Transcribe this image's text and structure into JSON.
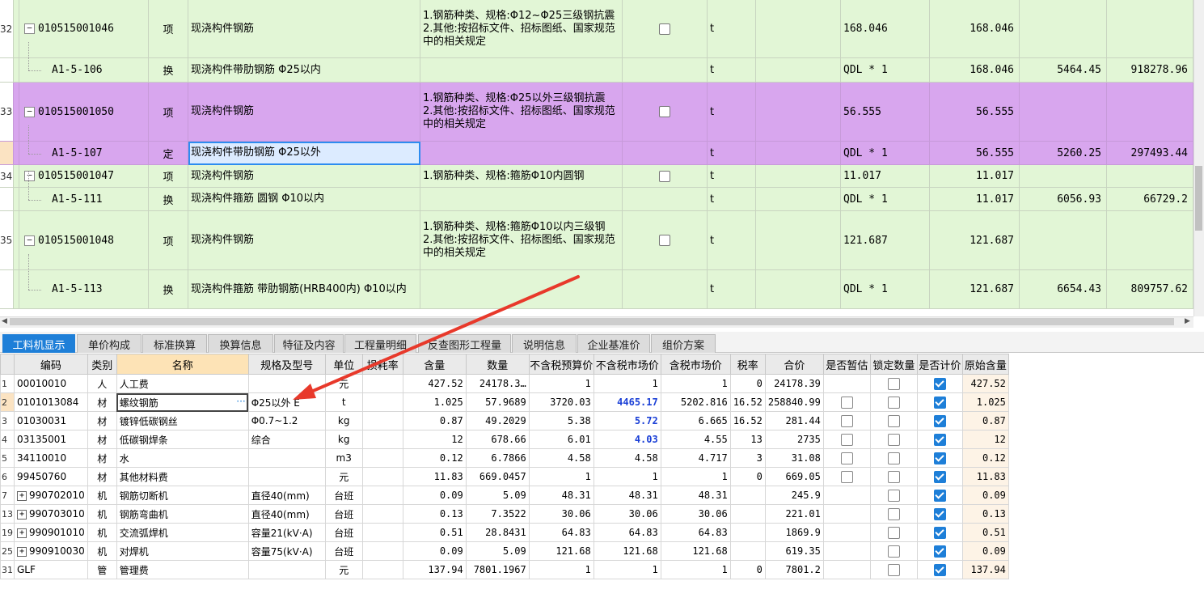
{
  "upper": {
    "rows": [
      {
        "idx": "32",
        "tree": "−",
        "code": "010515001046",
        "type": "项",
        "name": "现浇构件钢筋",
        "feature": "1.钢筋种类、规格:Φ12~Φ25三级钢抗震\n2.其他:按招标文件、招标图纸、国家规范中的相关规定",
        "unit": "t",
        "expr": "168.046",
        "qty": "168.046",
        "price": "",
        "total": ""
      },
      {
        "idx": "",
        "tree": "",
        "code": "A1-5-106",
        "type": "换",
        "name": "现浇构件带肋钢筋 Φ25以内",
        "feature": "",
        "unit": "t",
        "expr": "QDL * 1",
        "qty": "168.046",
        "price": "5464.45",
        "total": "918278.96"
      },
      {
        "idx": "33",
        "tree": "−",
        "code": "010515001050",
        "type": "项",
        "name": "现浇构件钢筋",
        "feature": "1.钢筋种类、规格:Φ25以外三级钢抗震\n2.其他:按招标文件、招标图纸、国家规范中的相关规定",
        "unit": "t",
        "expr": "56.555",
        "qty": "56.555",
        "price": "",
        "total": ""
      },
      {
        "idx": "",
        "tree": "",
        "code": "A1-5-107",
        "type": "定",
        "name": "现浇构件带肋钢筋 Φ25以外",
        "feature": "",
        "unit": "t",
        "expr": "QDL * 1",
        "qty": "56.555",
        "price": "5260.25",
        "total": "297493.44"
      },
      {
        "idx": "34",
        "tree": "−",
        "code": "010515001047",
        "type": "项",
        "name": "现浇构件钢筋",
        "feature": "1.钢筋种类、规格:箍筋Φ10内圆钢",
        "unit": "t",
        "expr": "11.017",
        "qty": "11.017",
        "price": "",
        "total": ""
      },
      {
        "idx": "",
        "tree": "",
        "code": "A1-5-111",
        "type": "换",
        "name": "现浇构件箍筋 圆钢 Φ10以内",
        "feature": "",
        "unit": "t",
        "expr": "QDL * 1",
        "qty": "11.017",
        "price": "6056.93",
        "total": "66729.2"
      },
      {
        "idx": "35",
        "tree": "−",
        "code": "010515001048",
        "type": "项",
        "name": "现浇构件钢筋",
        "feature": "1.钢筋种类、规格:箍筋Φ10以内三级钢\n2.其他:按招标文件、招标图纸、国家规范中的相关规定",
        "unit": "t",
        "expr": "121.687",
        "qty": "121.687",
        "price": "",
        "total": ""
      },
      {
        "idx": "",
        "tree": "",
        "code": "A1-5-113",
        "type": "换",
        "name": "现浇构件箍筋 带肋钢筋(HRB400内) Φ10以内",
        "feature": "",
        "unit": "t",
        "expr": "QDL * 1",
        "qty": "121.687",
        "price": "6654.43",
        "total": "809757.62"
      }
    ]
  },
  "tabs": [
    "工料机显示",
    "单价构成",
    "标准换算",
    "换算信息",
    "特征及内容",
    "工程量明细",
    "反查图形工程量",
    "说明信息",
    "企业基准价",
    "组价方案"
  ],
  "lower": {
    "headers": [
      "编码",
      "类别",
      "名称",
      "规格及型号",
      "单位",
      "损耗率",
      "含量",
      "数量",
      "不含税预算价",
      "不含税市场价",
      "含税市场价",
      "税率",
      "合价",
      "是否暂估",
      "锁定数量",
      "是否计价",
      "原始含量"
    ],
    "rows": [
      {
        "ix": "1",
        "plus": false,
        "code": "00010010",
        "cat": "人",
        "name": "人工费",
        "spec": "",
        "unit": "元",
        "loss": "",
        "content": "427.52",
        "qty": "24178.3…",
        "pre": "1",
        "mkt": "1",
        "mktBlue": false,
        "tax_mkt": "1",
        "rate": "0",
        "total": "24178.39",
        "est": null,
        "lock": false,
        "price": true,
        "orig": "427.52"
      },
      {
        "ix": "2",
        "plus": false,
        "code": "0101013084",
        "cat": "材",
        "name": "螺纹钢筋",
        "spec": "Φ25以外 E",
        "unit": "t",
        "loss": "",
        "content": "1.025",
        "qty": "57.9689",
        "pre": "3720.03",
        "mkt": "4465.17",
        "mktBlue": true,
        "tax_mkt": "5202.816",
        "rate": "16.52",
        "total": "258840.99",
        "est": false,
        "lock": false,
        "price": true,
        "orig": "1.025"
      },
      {
        "ix": "3",
        "plus": false,
        "code": "01030031",
        "cat": "材",
        "name": "镀锌低碳钢丝",
        "spec": "Φ0.7~1.2",
        "unit": "kg",
        "loss": "",
        "content": "0.87",
        "qty": "49.2029",
        "pre": "5.38",
        "mkt": "5.72",
        "mktBlue": true,
        "tax_mkt": "6.665",
        "rate": "16.52",
        "total": "281.44",
        "est": false,
        "lock": false,
        "price": true,
        "orig": "0.87"
      },
      {
        "ix": "4",
        "plus": false,
        "code": "03135001",
        "cat": "材",
        "name": "低碳钢焊条",
        "spec": "综合",
        "unit": "kg",
        "loss": "",
        "content": "12",
        "qty": "678.66",
        "pre": "6.01",
        "mkt": "4.03",
        "mktBlue": true,
        "tax_mkt": "4.55",
        "rate": "13",
        "total": "2735",
        "est": false,
        "lock": false,
        "price": true,
        "orig": "12"
      },
      {
        "ix": "5",
        "plus": false,
        "code": "34110010",
        "cat": "材",
        "name": "水",
        "spec": "",
        "unit": "m3",
        "loss": "",
        "content": "0.12",
        "qty": "6.7866",
        "pre": "4.58",
        "mkt": "4.58",
        "mktBlue": false,
        "tax_mkt": "4.717",
        "rate": "3",
        "total": "31.08",
        "est": false,
        "lock": false,
        "price": true,
        "orig": "0.12"
      },
      {
        "ix": "6",
        "plus": false,
        "code": "99450760",
        "cat": "材",
        "name": "其他材料费",
        "spec": "",
        "unit": "元",
        "loss": "",
        "content": "11.83",
        "qty": "669.0457",
        "pre": "1",
        "mkt": "1",
        "mktBlue": false,
        "tax_mkt": "1",
        "rate": "0",
        "total": "669.05",
        "est": false,
        "lock": false,
        "price": true,
        "orig": "11.83"
      },
      {
        "ix": "7",
        "plus": true,
        "code": "990702010",
        "cat": "机",
        "name": "钢筋切断机",
        "spec": "直径40(mm)",
        "unit": "台班",
        "loss": "",
        "content": "0.09",
        "qty": "5.09",
        "pre": "48.31",
        "mkt": "48.31",
        "mktBlue": false,
        "tax_mkt": "48.31",
        "rate": "",
        "total": "245.9",
        "est": null,
        "lock": false,
        "price": true,
        "orig": "0.09"
      },
      {
        "ix": "13",
        "plus": true,
        "code": "990703010",
        "cat": "机",
        "name": "钢筋弯曲机",
        "spec": "直径40(mm)",
        "unit": "台班",
        "loss": "",
        "content": "0.13",
        "qty": "7.3522",
        "pre": "30.06",
        "mkt": "30.06",
        "mktBlue": false,
        "tax_mkt": "30.06",
        "rate": "",
        "total": "221.01",
        "est": null,
        "lock": false,
        "price": true,
        "orig": "0.13"
      },
      {
        "ix": "19",
        "plus": true,
        "code": "990901010",
        "cat": "机",
        "name": "交流弧焊机",
        "spec": "容量21(kV·A)",
        "unit": "台班",
        "loss": "",
        "content": "0.51",
        "qty": "28.8431",
        "pre": "64.83",
        "mkt": "64.83",
        "mktBlue": false,
        "tax_mkt": "64.83",
        "rate": "",
        "total": "1869.9",
        "est": null,
        "lock": false,
        "price": true,
        "orig": "0.51"
      },
      {
        "ix": "25",
        "plus": true,
        "code": "990910030",
        "cat": "机",
        "name": "对焊机",
        "spec": "容量75(kV·A)",
        "unit": "台班",
        "loss": "",
        "content": "0.09",
        "qty": "5.09",
        "pre": "121.68",
        "mkt": "121.68",
        "mktBlue": false,
        "tax_mkt": "121.68",
        "rate": "",
        "total": "619.35",
        "est": null,
        "lock": false,
        "price": true,
        "orig": "0.09"
      },
      {
        "ix": "31",
        "plus": false,
        "code": "GLF",
        "cat": "管",
        "name": "管理费",
        "spec": "",
        "unit": "元",
        "loss": "",
        "content": "137.94",
        "qty": "7801.1967",
        "pre": "1",
        "mkt": "1",
        "mktBlue": false,
        "tax_mkt": "1",
        "rate": "0",
        "total": "7801.2",
        "est": null,
        "lock": false,
        "price": true,
        "orig": "137.94"
      }
    ]
  },
  "colors": {
    "green": "#e2f6d6",
    "purple": "#d8a6ee",
    "tabActive": "#1e7fd8",
    "arrow": "#e8392b",
    "blueValue": "#1a3fd6"
  }
}
